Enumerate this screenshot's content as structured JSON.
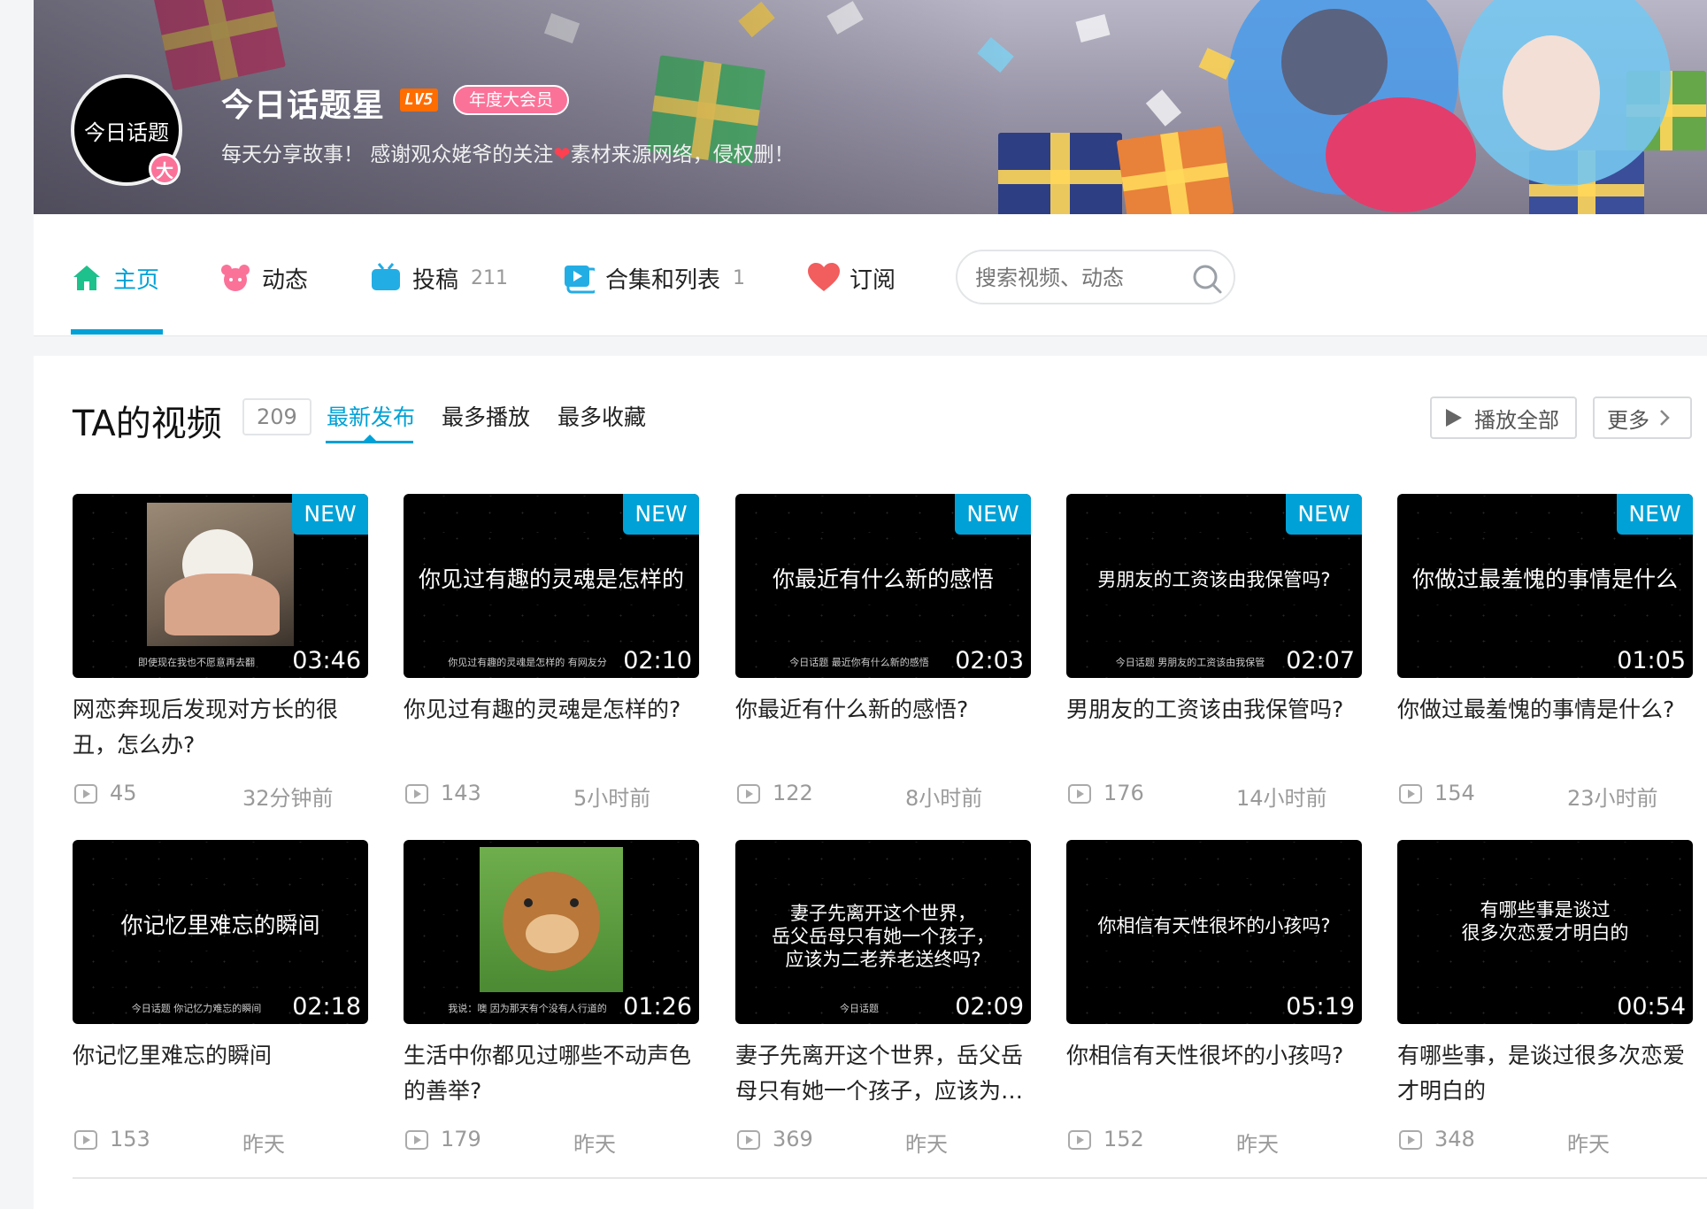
{
  "profile": {
    "avatar_text": "今日话题",
    "avatar_badge": "大",
    "name": "今日话题星",
    "level": "LV5",
    "vip": "年度大会员",
    "sign_part1": "每天分享故事！ 感谢观众姥爷的关注",
    "sign_part2": "素材来源网络，侵权删！"
  },
  "nav": {
    "items": [
      {
        "label": "主页",
        "icon": "home-icon",
        "count": ""
      },
      {
        "label": "动态",
        "icon": "dynamic-icon",
        "count": ""
      },
      {
        "label": "投稿",
        "icon": "tv-icon",
        "count": "211"
      },
      {
        "label": "合集和列表",
        "icon": "collection-icon",
        "count": "1"
      },
      {
        "label": "订阅",
        "icon": "heart-icon",
        "count": ""
      }
    ],
    "search_placeholder": "搜索视频、动态"
  },
  "videos": {
    "title": "TA的视频",
    "count": "209",
    "sort_tabs": [
      "最新发布",
      "最多播放",
      "最多收藏"
    ],
    "play_all": "播放全部",
    "more": "更多",
    "items": [
      {
        "title": "网恋奔现后发现对方长的很丑，怎么办?",
        "caption": "",
        "subtitle": "即使现在我也不愿意再去翻",
        "duration": "03:46",
        "plays": "45",
        "time": "32分钟前",
        "new": "NEW",
        "pic": "hamster"
      },
      {
        "title": "你见过有趣的灵魂是怎样的?",
        "caption": "你见过有趣的灵魂是怎样的",
        "subtitle": "你见过有趣的灵魂是怎样的 有网友分",
        "duration": "02:10",
        "plays": "143",
        "time": "5小时前",
        "new": "NEW",
        "pic": ""
      },
      {
        "title": "你最近有什么新的感悟?",
        "caption": "你最近有什么新的感悟",
        "subtitle": "今日话题 最近你有什么新的感悟",
        "duration": "02:03",
        "plays": "122",
        "time": "8小时前",
        "new": "NEW",
        "pic": ""
      },
      {
        "title": "男朋友的工资该由我保管吗?",
        "caption": "男朋友的工资该由我保管吗?",
        "subtitle": "今日话题 男朋友的工资该由我保管",
        "duration": "02:07",
        "plays": "176",
        "time": "14小时前",
        "new": "NEW",
        "pic": ""
      },
      {
        "title": "你做过最羞愧的事情是什么?",
        "caption": "你做过最羞愧的事情是什么",
        "subtitle": "",
        "duration": "01:05",
        "plays": "154",
        "time": "23小时前",
        "new": "NEW",
        "pic": ""
      },
      {
        "title": "你记忆里难忘的瞬间",
        "caption": "你记忆里难忘的瞬间",
        "subtitle": "今日话题 你记忆力难忘的瞬间",
        "duration": "02:18",
        "plays": "153",
        "time": "昨天",
        "new": "",
        "pic": ""
      },
      {
        "title": "生活中你都见过哪些不动声色的善举?",
        "caption": "",
        "subtitle": "我说：噢 因为那天有个没有人行道的",
        "duration": "01:26",
        "plays": "179",
        "time": "昨天",
        "new": "",
        "pic": "bear"
      },
      {
        "title": "妻子先离开这个世界，岳父岳母只有她一个孩子，应该为二老养老送终吗?",
        "caption": "妻子先离开这个世界，\n岳父岳母只有她一个孩子，\n应该为二老养老送终吗?",
        "subtitle": "今日话题",
        "duration": "02:09",
        "plays": "369",
        "time": "昨天",
        "new": "",
        "pic": ""
      },
      {
        "title": "你相信有天性很坏的小孩吗?",
        "caption": "你相信有天性很坏的小孩吗?",
        "subtitle": "",
        "duration": "05:19",
        "plays": "152",
        "time": "昨天",
        "new": "",
        "pic": ""
      },
      {
        "title": "有哪些事，是谈过很多次恋爱才明白的",
        "caption": "有哪些事是谈过\n很多次恋爱才明白的",
        "subtitle": "",
        "duration": "00:54",
        "plays": "348",
        "time": "昨天",
        "new": "",
        "pic": ""
      }
    ]
  },
  "colors": {
    "accent": "#00a1d6",
    "pink": "#fb7299",
    "level": "#ff6c00"
  }
}
